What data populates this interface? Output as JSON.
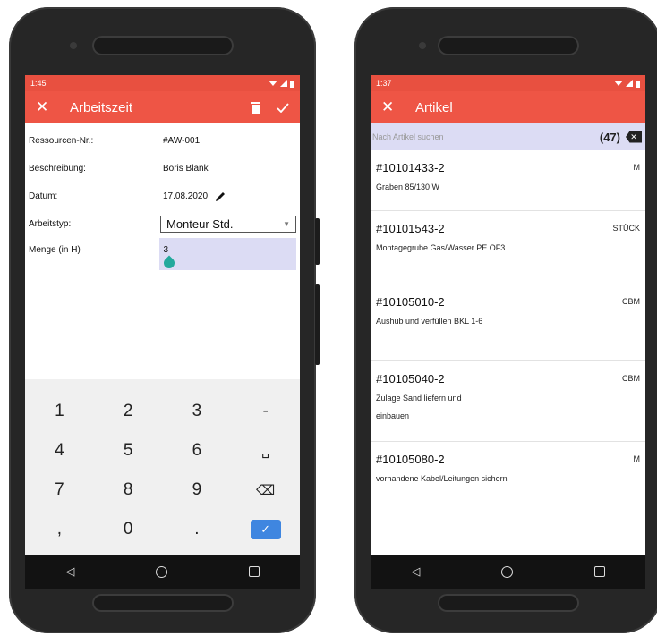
{
  "left": {
    "status_time": "1:45",
    "title": "Arbeitszeit",
    "fields": [
      {
        "label": "Ressourcen-Nr.:",
        "value": "#AW-001"
      },
      {
        "label": "Beschreibung:",
        "value": "Boris Blank"
      },
      {
        "label": "Datum:",
        "value": "17.08.2020"
      },
      {
        "label": "Arbeitstyp:",
        "value": "Monteur Std."
      },
      {
        "label": "Menge (in H)",
        "value": "3"
      }
    ],
    "keypad": [
      [
        "1",
        "2",
        "3",
        "-"
      ],
      [
        "4",
        "5",
        "6",
        "␣"
      ],
      [
        "7",
        "8",
        "9",
        "⌫"
      ],
      [
        ",",
        "0",
        ".",
        "✓"
      ]
    ]
  },
  "right": {
    "status_time": "1:37",
    "title": "Artikel",
    "search_placeholder": "Nach Artikel suchen",
    "count": "(47)",
    "items": [
      {
        "code": "#10101433-2",
        "desc": "Graben 85/130 W",
        "unit": "M"
      },
      {
        "code": "#10101543-2",
        "desc": "Montagegrube Gas/Wasser PE OF3",
        "unit": "STÜCK"
      },
      {
        "code": "#10105010-2",
        "desc": "Aushub und verfüllen BKL 1-6",
        "unit": "CBM"
      },
      {
        "code": "#10105040-2",
        "desc": "Zulage Sand liefern und einbauen",
        "unit": "CBM"
      },
      {
        "code": "#10105080-2",
        "desc": "vorhandene Kabel/Leitungen sichern",
        "unit": "M"
      }
    ]
  },
  "colors": {
    "appbar": "#ee5545",
    "statusbar": "#e85040",
    "input_bg": "#dcdcf4",
    "accent_blue": "#3f86e0",
    "teal": "#23a99c"
  },
  "icons": {
    "close": "close-icon",
    "delete": "trash-icon",
    "save": "check-icon",
    "edit": "pencil-icon",
    "clear": "backspace-icon"
  }
}
